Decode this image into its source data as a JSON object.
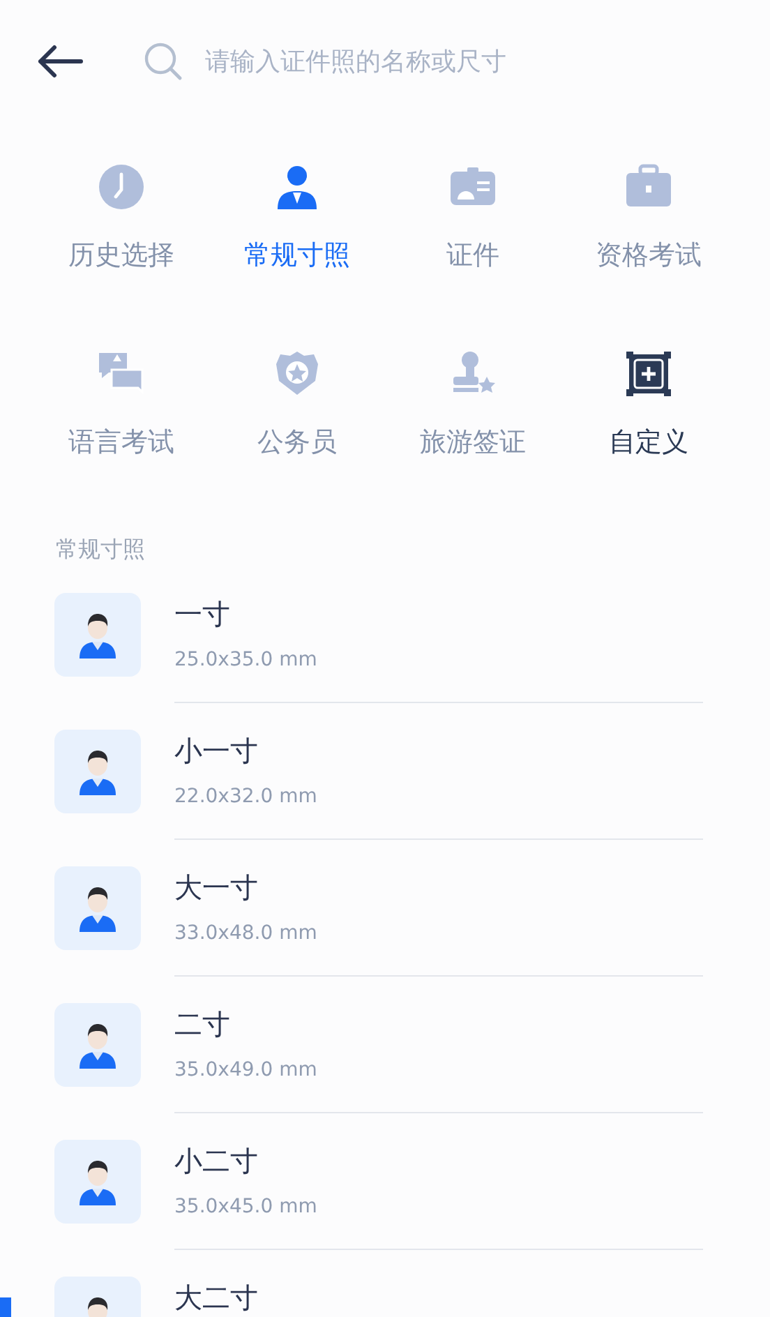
{
  "search": {
    "placeholder": "请输入证件照的名称或尺寸"
  },
  "categories": [
    {
      "label": "历史选择",
      "selected": false,
      "kind": "preset"
    },
    {
      "label": "常规寸照",
      "selected": true,
      "kind": "preset"
    },
    {
      "label": "证件",
      "selected": false,
      "kind": "preset"
    },
    {
      "label": "资格考试",
      "selected": false,
      "kind": "preset"
    },
    {
      "label": "语言考试",
      "selected": false,
      "kind": "preset"
    },
    {
      "label": "公务员",
      "selected": false,
      "kind": "preset"
    },
    {
      "label": "旅游签证",
      "selected": false,
      "kind": "preset"
    },
    {
      "label": "自定义",
      "selected": false,
      "kind": "custom"
    }
  ],
  "section_title": "常规寸照",
  "sizes": [
    {
      "name": "一寸",
      "size": "25.0x35.0 mm"
    },
    {
      "name": "小一寸",
      "size": "22.0x32.0 mm"
    },
    {
      "name": "大一寸",
      "size": "33.0x48.0 mm"
    },
    {
      "name": "二寸",
      "size": "35.0x49.0 mm"
    },
    {
      "name": "小二寸",
      "size": "35.0x45.0 mm"
    },
    {
      "name": "大二寸"
    }
  ]
}
